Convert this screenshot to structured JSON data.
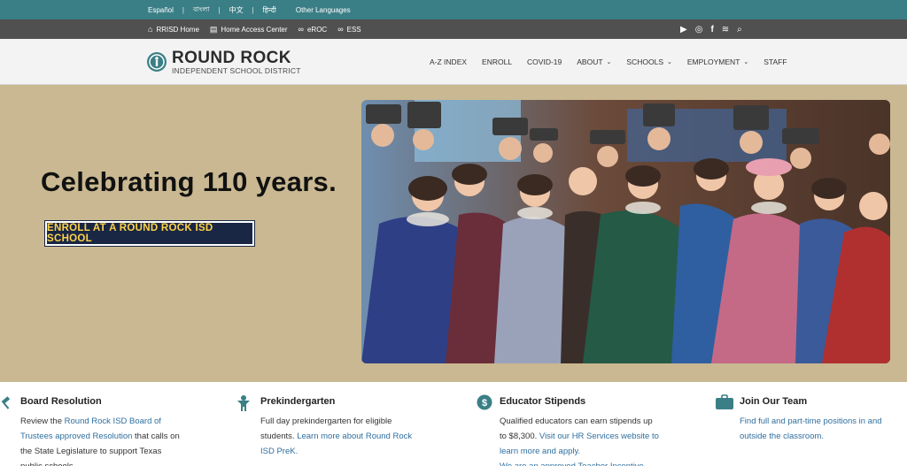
{
  "languages": {
    "items": [
      "Español",
      "বাংলা",
      "中文",
      "हिन्दी"
    ],
    "other": "Other Languages"
  },
  "utility": {
    "links": [
      {
        "icon": "building-icon",
        "label": "RRISD Home"
      },
      {
        "icon": "document-icon",
        "label": "Home Access Center"
      },
      {
        "icon": "link-icon",
        "label": "eROC"
      },
      {
        "icon": "link-icon",
        "label": "ESS"
      }
    ],
    "social": [
      "youtube-icon",
      "instagram-icon",
      "facebook-icon",
      "rss-icon",
      "search-icon"
    ]
  },
  "header": {
    "logo_title": "ROUND ROCK",
    "logo_subtitle": "INDEPENDENT SCHOOL DISTRICT",
    "menu": [
      {
        "label": "A-Z INDEX",
        "dropdown": false
      },
      {
        "label": "ENROLL",
        "dropdown": false
      },
      {
        "label": "COVID-19",
        "dropdown": false
      },
      {
        "label": "ABOUT",
        "dropdown": true
      },
      {
        "label": "SCHOOLS",
        "dropdown": true
      },
      {
        "label": "EMPLOYMENT",
        "dropdown": true
      },
      {
        "label": "STAFF",
        "dropdown": false
      }
    ]
  },
  "hero": {
    "title": "Celebrating 110 years.",
    "cta": "ENROLL AT A ROUND ROCK ISD SCHOOL",
    "colors": {
      "background": "#c9b891",
      "cta_bg": "#1a2744",
      "cta_text": "#ffd24a"
    }
  },
  "features": [
    {
      "icon": "gavel-icon",
      "title": "Board Resolution",
      "lines": [
        [
          {
            "t": "Review the "
          },
          {
            "t": "Round Rock ISD Board of",
            "link": true
          }
        ],
        [
          {
            "t": "Trustees approved Resolution",
            "link": true
          },
          {
            "t": " that calls on"
          }
        ],
        [
          {
            "t": "the State Legislature to support Texas"
          }
        ],
        [
          {
            "t": "public schools."
          }
        ]
      ]
    },
    {
      "icon": "child-icon",
      "title": "Prekindergarten",
      "lines": [
        [
          {
            "t": "Full day prekindergarten for eligible"
          }
        ],
        [
          {
            "t": "students. "
          },
          {
            "t": "Learn more about Round Rock",
            "link": true
          }
        ],
        [
          {
            "t": "ISD PreK.",
            "link": true
          }
        ]
      ]
    },
    {
      "icon": "dollar-icon",
      "title": "Educator Stipends",
      "lines": [
        [
          {
            "t": "Qualified educators can earn stipends up"
          }
        ],
        [
          {
            "t": "to $8,300. "
          },
          {
            "t": "Visit our HR Services website to",
            "link": true
          }
        ],
        [
          {
            "t": "learn more and apply.",
            "link": true
          }
        ],
        [
          {
            "t": "We are an approved Teacher Incentive",
            "link": true
          }
        ]
      ]
    },
    {
      "icon": "briefcase-icon",
      "title": "Join Our Team",
      "lines": [
        [
          {
            "t": "Find full and part-time positions in and",
            "link": true
          }
        ],
        [
          {
            "t": "outside the classroom.",
            "link": true
          }
        ]
      ]
    }
  ],
  "colors": {
    "teal": "#3b7f86",
    "dark_bar": "#505050",
    "link": "#2f6f9f"
  }
}
